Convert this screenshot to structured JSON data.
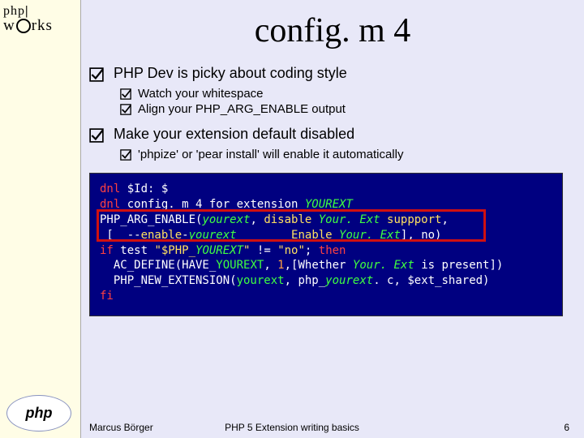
{
  "logo": {
    "line1a": "php",
    "line1b": "|",
    "line2_pre": "w",
    "line2_post": "rks",
    "bottom": "php"
  },
  "title": "config. m 4",
  "bullets": [
    {
      "text": "PHP Dev is picky about coding style"
    },
    {
      "text": "Watch your whitespace",
      "sub": true
    },
    {
      "text": "Align your PHP_ARG_ENABLE output",
      "sub": true
    },
    {
      "text": "Make your extension default disabled"
    },
    {
      "text": "'phpize' or 'pear install' will enable it automatically",
      "sub": true
    }
  ],
  "code": {
    "l1a": "dnl",
    "l1b": " $Id: $",
    "l2a": "dnl",
    "l2b": " config. m 4 for extension ",
    "l2c": "YOUREXT",
    "l3a": "PHP_ARG_ENABLE(",
    "l3b": "yourext",
    "l3c": ", ",
    "l3d": "disable ",
    "l3e": "Your. Ext",
    "l3f": " suppport",
    "l3g": ",",
    "l4a": " [  --",
    "l4b": "enable",
    "l4c": "-",
    "l4d": "yourext",
    "l4e": "        Enable ",
    "l4f": "Your. Ext",
    "l4g": "]",
    "l4h": ", no)",
    "l5a": "if",
    "l5b": " test ",
    "l5c": "\"$PHP_",
    "l5d": "YOUREXT",
    "l5e": "\"",
    "l5f": " != ",
    "l5g": "\"no\"",
    "l5h": "; ",
    "l5i": "then",
    "l6a": "  AC_DEFINE(HAVE_",
    "l6b": "YOUREXT",
    "l6c": ", ",
    "l6d": "1",
    "l6e": ",[Whether ",
    "l6f": "Your. Ext",
    "l6g": " is present])",
    "l7a": "  PHP_NEW_EXTENSION(",
    "l7b": "yourext",
    "l7c": ", php_",
    "l7d": "yourext",
    "l7e": ". c, $ext_shared)",
    "l8": "fi"
  },
  "footer": {
    "left": "Marcus Börger",
    "center": "PHP 5 Extension writing basics",
    "right": "6"
  }
}
